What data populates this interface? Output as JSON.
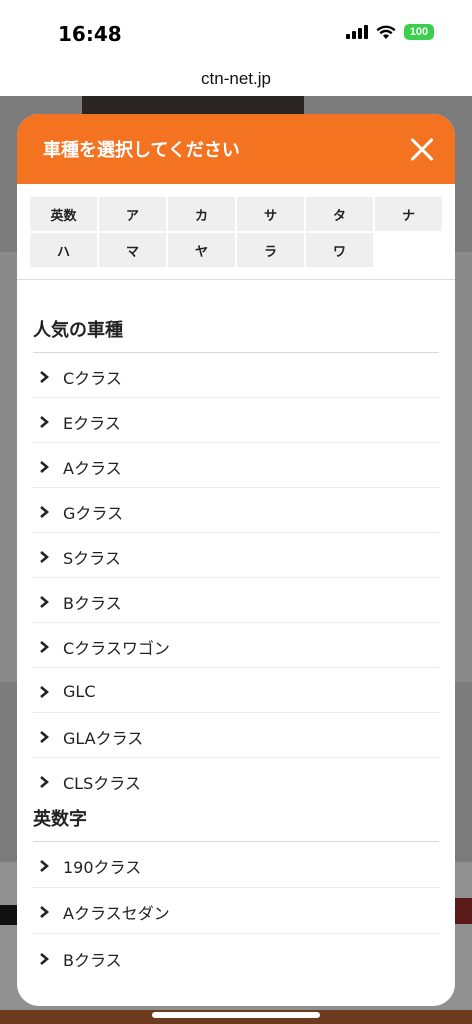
{
  "status_bar": {
    "time": "16:48",
    "battery": "100"
  },
  "browser": {
    "url": "ctn-net.jp"
  },
  "modal": {
    "title": "車種を選択してください",
    "index_tabs": [
      "英数",
      "ア",
      "カ",
      "サ",
      "タ",
      "ナ",
      "ハ",
      "マ",
      "ヤ",
      "ラ",
      "ワ"
    ],
    "sections": [
      {
        "title": "人気の車種",
        "items": [
          "Cクラス",
          "Eクラス",
          "Aクラス",
          "Gクラス",
          "Sクラス",
          "Bクラス",
          "Cクラスワゴン",
          "GLC",
          "GLAクラス",
          "CLSクラス"
        ]
      },
      {
        "title": "英数字",
        "items": [
          "190クラス",
          "Aクラスセダン",
          "Bクラス"
        ]
      }
    ]
  },
  "colors": {
    "accent": "#f37321",
    "battery": "#3ccf4e"
  }
}
